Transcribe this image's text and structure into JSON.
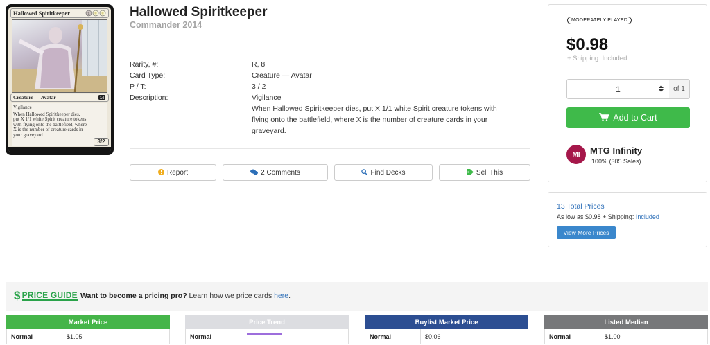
{
  "card": {
    "image": {
      "name": "Hallowed Spiritkeeper",
      "mana": "{1}{W}{W}",
      "type_line": "Creature — Avatar",
      "text_lines": [
        "Vigilance",
        "When Hallowed Spiritkeeper dies,",
        "put X 1/1 white Spirit creature tokens",
        "with flying onto the battlefield, where",
        "X is the number of creature cards in",
        "your graveyard."
      ],
      "pt": "3/2"
    },
    "title": "Hallowed Spiritkeeper",
    "set": "Commander 2014"
  },
  "details": {
    "rows": [
      {
        "label": "Rarity, #:",
        "value": "R, 8"
      },
      {
        "label": "Card Type:",
        "value": "Creature — Avatar"
      },
      {
        "label": "P / T:",
        "value": "3 / 2"
      },
      {
        "label": "Description:",
        "value": "Vigilance"
      }
    ],
    "description_lines": [
      "When Hallowed Spiritkeeper dies, put X 1/1 white Spirit creature tokens with",
      "flying onto the battlefield, where X is the number of creature cards in your",
      "graveyard."
    ]
  },
  "actions": {
    "report": "Report",
    "comments": "2 Comments",
    "find_decks": "Find Decks",
    "sell_this": "Sell This"
  },
  "listing": {
    "condition": "MODERATELY PLAYED",
    "price": "$0.98",
    "shipping": "+ Shipping: Included",
    "quantity": "1",
    "of": "of 1",
    "add_to_cart": "Add to Cart",
    "seller": {
      "initials": "MI",
      "name": "MTG Infinity",
      "rating": "100% (305 Sales)"
    }
  },
  "more_prices": {
    "title": "13 Total Prices",
    "sub_prefix": "As low as $0.98 + Shipping:",
    "sub_included": "Included",
    "button": "View More Prices"
  },
  "price_guide": {
    "logo": "PRICE GUIDE",
    "pro_bold": "Want to become a pricing pro?",
    "pro_text": "Learn how we price cards",
    "pro_link": "here",
    "pro_end": ".",
    "tables": [
      {
        "header": "Market Price",
        "color": "#45b549",
        "label": "Normal",
        "value": "$1.05"
      },
      {
        "header": "Price Trend",
        "color": "#dcdde1",
        "label": "Normal",
        "value": ""
      },
      {
        "header": "Buylist Market Price",
        "color": "#2c4e92",
        "label": "Normal",
        "value": "$0.06"
      },
      {
        "header": "Listed Median",
        "color": "#77787a",
        "label": "Normal",
        "value": "$1.00"
      }
    ]
  }
}
